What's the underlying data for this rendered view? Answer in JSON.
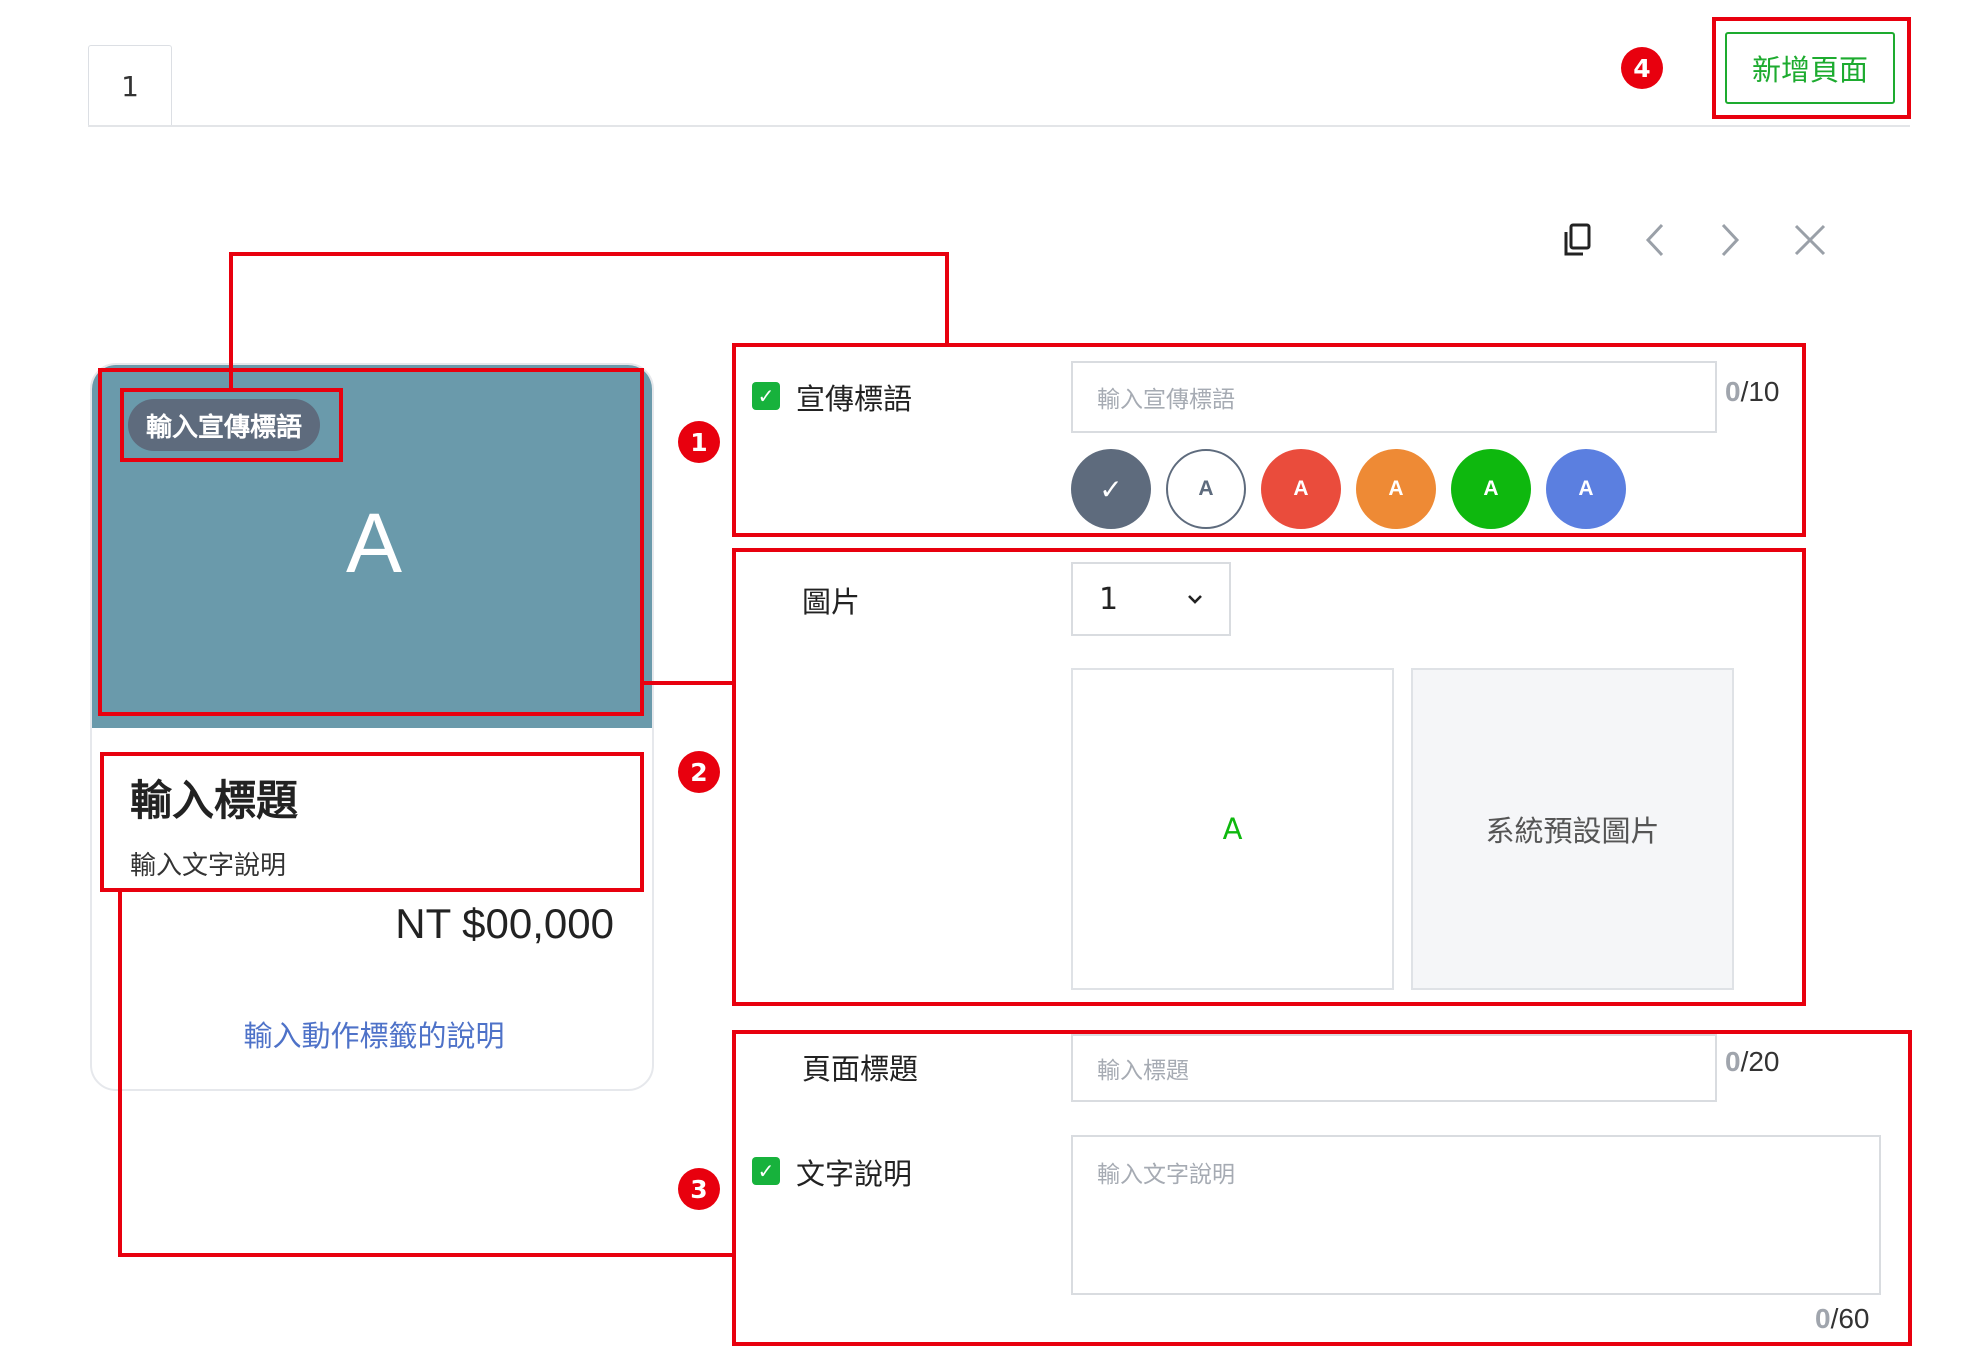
{
  "tabs": [
    {
      "label": "1"
    }
  ],
  "header": {
    "add_page_label": "新增頁面"
  },
  "toolbar": {
    "copy_icon": "copy-icon",
    "prev_icon": "chevron-left-icon",
    "next_icon": "chevron-right-icon",
    "close_icon": "close-icon"
  },
  "annotations": {
    "badge_1": "1",
    "badge_2": "2",
    "badge_3": "3",
    "badge_4": "4",
    "color": "#e8000e"
  },
  "preview_card": {
    "tag": "輸入宣傳標語",
    "image_letter": "A",
    "image_color": "#6a9aab",
    "title": "輸入標題",
    "description": "輸入文字說明",
    "price": "NT $00,000",
    "action": "輸入動作標籤的說明"
  },
  "form": {
    "slogan": {
      "label": "宣傳標語",
      "checked": true,
      "placeholder": "輸入宣傳標語",
      "counter_current": "0",
      "counter_max": "/10",
      "colors": [
        {
          "name": "gray",
          "hex": "#5e6b7d",
          "selected": true,
          "letter": "✓"
        },
        {
          "name": "white",
          "hex": "#ffffff",
          "selected": false,
          "letter": "A"
        },
        {
          "name": "red",
          "hex": "#ea4c3c",
          "selected": false,
          "letter": "A"
        },
        {
          "name": "orange",
          "hex": "#ee8a35",
          "selected": false,
          "letter": "A"
        },
        {
          "name": "green",
          "hex": "#0eb80e",
          "selected": false,
          "letter": "A"
        },
        {
          "name": "blue",
          "hex": "#5b7fe0",
          "selected": false,
          "letter": "A"
        }
      ]
    },
    "image": {
      "label": "圖片",
      "selected_count": "1",
      "slot_1_letter": "A",
      "slot_2_label": "系統預設圖片"
    },
    "page_title": {
      "label": "頁面標題",
      "placeholder": "輸入標題",
      "counter_current": "0",
      "counter_max": "/20"
    },
    "text_description": {
      "label": "文字說明",
      "checked": true,
      "placeholder": "輸入文字說明",
      "counter_current": "0",
      "counter_max": "/60"
    }
  }
}
